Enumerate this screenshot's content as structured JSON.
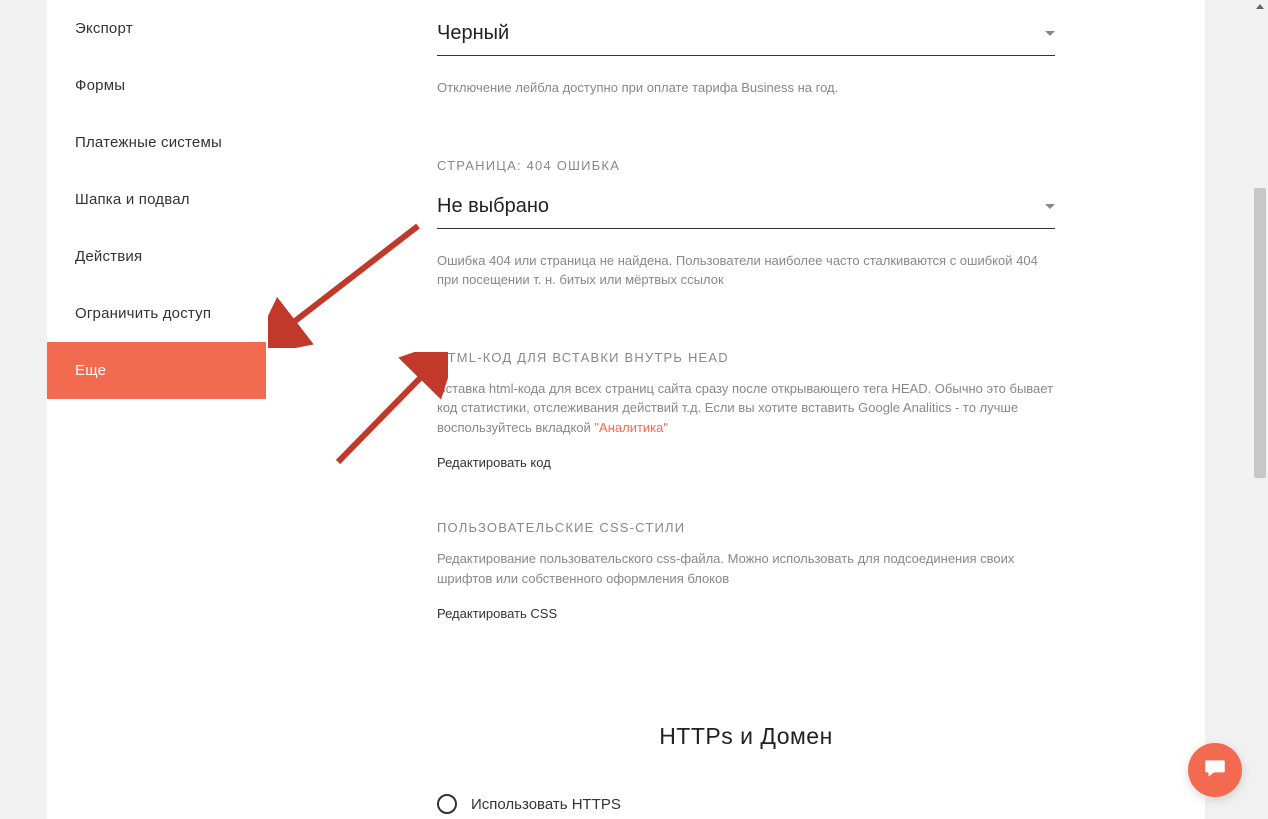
{
  "sidebar": {
    "items": [
      {
        "label": "Экспорт"
      },
      {
        "label": "Формы"
      },
      {
        "label": "Платежные системы"
      },
      {
        "label": "Шапка и подвал"
      },
      {
        "label": "Действия"
      },
      {
        "label": "Ограничить доступ"
      },
      {
        "label": "Еще"
      }
    ]
  },
  "label_color": {
    "value": "Черный",
    "help": "Отключение лейбла доступно при оплате тарифа Business на год."
  },
  "page404": {
    "section": "СТРАНИЦА: 404 ОШИБКА",
    "value": "Не выбрано",
    "help": "Ошибка 404 или страница не найдена. Пользователи наиболее часто сталкиваются с ошибкой 404 при посещении т. н. битых или мёртвых ссылок"
  },
  "head_html": {
    "section": "HTML-КОД ДЛЯ ВСТАВКИ ВНУТРЬ HEAD",
    "help_before": "Вставка html-кода для всех страниц сайта сразу после открывающего тега HEAD. Обычно это бывает код статистики, отслеживания действий т.д. Если вы хотите вставить Google Analitics - то лучше воспользуйтесь вкладкой ",
    "link": "\"Аналитика\"",
    "action": "Редактировать код"
  },
  "css": {
    "section": "ПОЛЬЗОВАТЕЛЬСКИЕ CSS-СТИЛИ",
    "help": "Редактирование пользовательского css-файла. Можно использовать для подсоединения своих шрифтов или собственного оформления блоков",
    "action": "Редактировать CSS"
  },
  "https": {
    "heading": "HTTPs и Домен",
    "option": "Использовать HTTPS"
  }
}
